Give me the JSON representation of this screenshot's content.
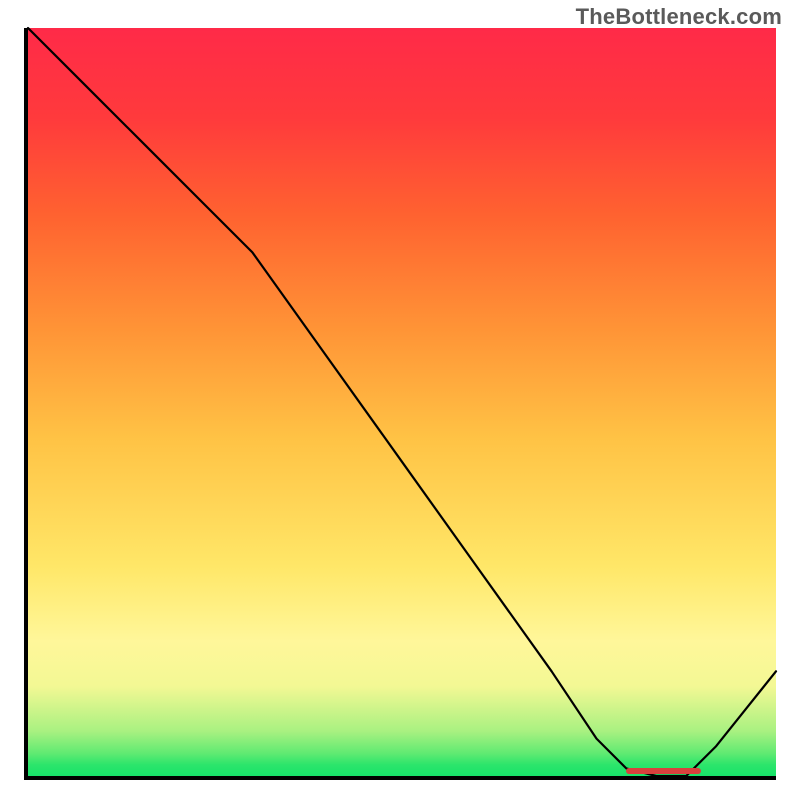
{
  "watermark": "TheBottleneck.com",
  "chart_data": {
    "type": "line",
    "title": "",
    "xlabel": "",
    "ylabel": "",
    "xlim": [
      0,
      100
    ],
    "ylim": [
      0,
      100
    ],
    "grid": false,
    "x": [
      0,
      8,
      16,
      24,
      30,
      40,
      50,
      60,
      70,
      76,
      80,
      84,
      88,
      92,
      96,
      100
    ],
    "values": [
      100,
      92,
      84,
      76,
      70,
      56,
      42,
      28,
      14,
      5,
      1,
      0,
      0,
      4,
      9,
      14
    ],
    "minimum_zone": {
      "x_start": 80,
      "x_end": 90,
      "y": 0
    },
    "background_gradient": {
      "top": "#ff2a48",
      "mid_upper": "#ff9336",
      "mid": "#ffe768",
      "mid_lower": "#f3f894",
      "bottom": "#17e36a"
    }
  }
}
